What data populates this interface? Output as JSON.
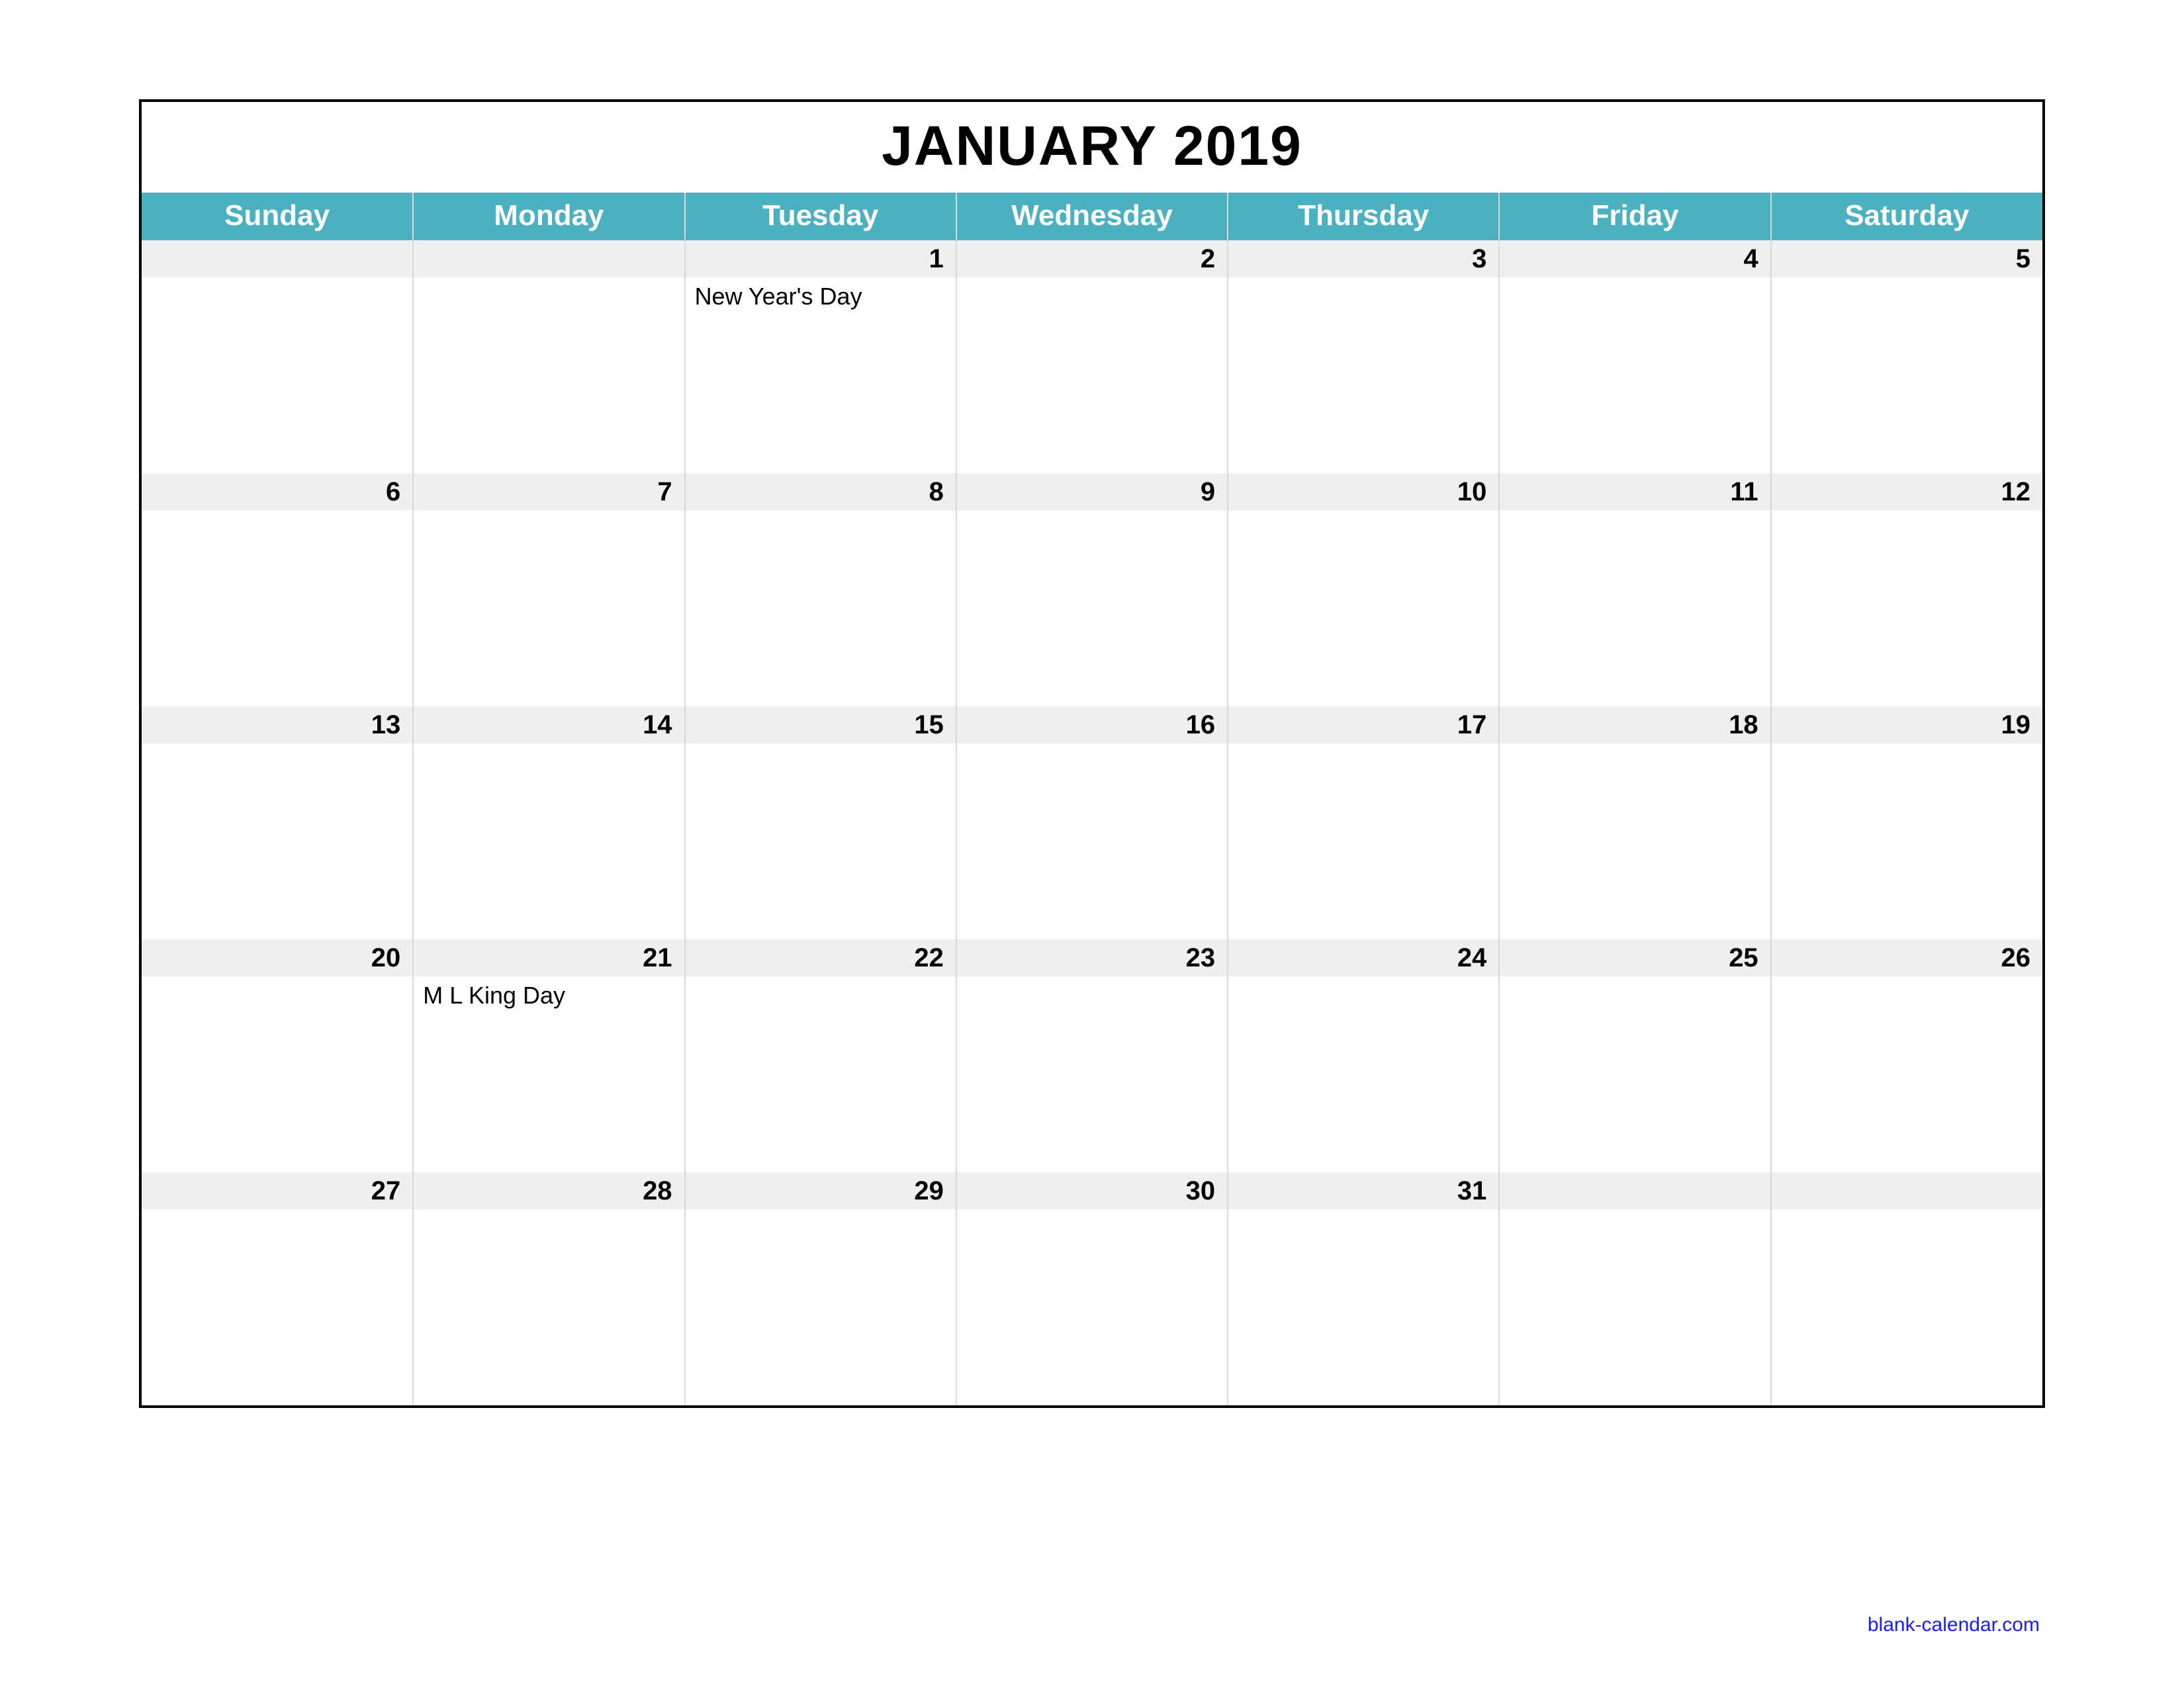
{
  "title": "JANUARY 2019",
  "colors": {
    "header_bg": "#4bb0bf",
    "num_bg": "#efefef"
  },
  "footer": "blank-calendar.com",
  "days_of_week": [
    "Sunday",
    "Monday",
    "Tuesday",
    "Wednesday",
    "Thursday",
    "Friday",
    "Saturday"
  ],
  "weeks": [
    {
      "nums": [
        "",
        "",
        "1",
        "2",
        "3",
        "4",
        "5"
      ],
      "notes": [
        "",
        "",
        "New Year's Day",
        "",
        "",
        "",
        ""
      ]
    },
    {
      "nums": [
        "6",
        "7",
        "8",
        "9",
        "10",
        "11",
        "12"
      ],
      "notes": [
        "",
        "",
        "",
        "",
        "",
        "",
        ""
      ]
    },
    {
      "nums": [
        "13",
        "14",
        "15",
        "16",
        "17",
        "18",
        "19"
      ],
      "notes": [
        "",
        "",
        "",
        "",
        "",
        "",
        ""
      ]
    },
    {
      "nums": [
        "20",
        "21",
        "22",
        "23",
        "24",
        "25",
        "26"
      ],
      "notes": [
        "",
        "M L King Day",
        "",
        "",
        "",
        "",
        ""
      ]
    },
    {
      "nums": [
        "27",
        "28",
        "29",
        "30",
        "31",
        "",
        ""
      ],
      "notes": [
        "",
        "",
        "",
        "",
        "",
        "",
        ""
      ]
    }
  ]
}
